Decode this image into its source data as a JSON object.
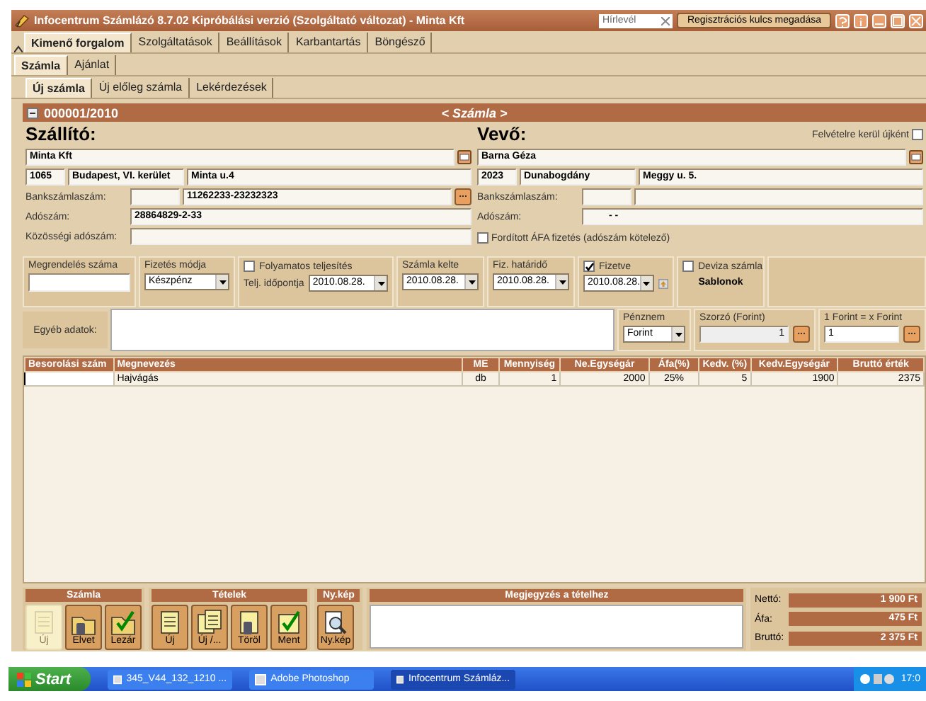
{
  "window": {
    "title": "Infocentrum Számlázó 8.7.02 Kipróbálási verzió (Szolgáltató változat) - Minta Kft",
    "search": {
      "placeholder": "Hírlevél"
    },
    "register_button": "Regisztrációs kulcs megadása"
  },
  "tabs": [
    {
      "label": "Kimenő forgalom",
      "selected": true
    },
    {
      "label": "Szolgáltatások",
      "selected": false
    },
    {
      "label": "Beállítások",
      "selected": false
    },
    {
      "label": "Karbantartás",
      "selected": false
    },
    {
      "label": "Böngésző",
      "selected": false
    }
  ],
  "subtabs": [
    {
      "label": "Számla",
      "selected": true
    },
    {
      "label": "Ajánlat",
      "selected": false
    }
  ],
  "invoice_tabs": [
    {
      "label": "Új számla",
      "selected": true
    },
    {
      "label": "Új előleg számla",
      "selected": false
    },
    {
      "label": "Lekérdezések",
      "selected": false
    }
  ],
  "invoice": {
    "number": "000001/2010",
    "type": "< Számla >"
  },
  "supplier": {
    "heading": "Szállító:",
    "name": "Minta Kft",
    "zip": "1065",
    "city": "Budapest, VI. kerület",
    "street": "Minta u.4",
    "bank_label": "Bankszámlaszám:",
    "bank_account": "11262233-23232323",
    "bank_button": "...",
    "tax_label": "Adószám:",
    "tax_number": "28864829-2-33",
    "eu_tax_label": "Közösségi adószám:"
  },
  "customer": {
    "heading": "Vevő:",
    "new_label": "Felvételre kerül újként",
    "new_checked": false,
    "name": "Barna Géza",
    "zip": "2023",
    "city": "Dunabogdány",
    "street": "Meggy u. 5.",
    "bank_label": "Bankszámlaszám:",
    "tax_label": "Adószám:",
    "tax_number": "- -",
    "reverse_vat_label": "Fordított ÁFA fizetés (adószám kötelező)",
    "reverse_vat_checked": false
  },
  "fields": [
    {
      "kind": "input",
      "label": "Megrendelés száma"
    },
    {
      "kind": "select",
      "label": "Fizetés módja",
      "value": "Készpénz"
    },
    {
      "kind": "check-date",
      "label": "Folyamatos teljesítés",
      "checked": false,
      "sublabel": "Telj. időpontja",
      "value": "2010.08.28."
    },
    {
      "kind": "date",
      "label": "Számla kelte",
      "value": "2010.08.28."
    },
    {
      "kind": "date",
      "label": "Fiz. határidő",
      "value": "2010.08.28."
    },
    {
      "kind": "check-date",
      "label": "Fizetve",
      "checked": true,
      "value": "2010.08.28.",
      "button": true
    },
    {
      "kind": "check-button",
      "label": "Deviza számla",
      "checked": false,
      "button_label": "Sablonok"
    }
  ],
  "other": {
    "label": "Egyéb adatok:",
    "currency_label": "Pénznem",
    "currency": "Forint",
    "multiplier_label": "Szorzó (Forint)",
    "multiplier": "1",
    "multiplier_button": "...",
    "rate_label": "1 Forint = x Forint",
    "rate": "1",
    "rate_button": "..."
  },
  "table": {
    "columns": [
      "Besorolási szám",
      "Megnevezés",
      "ME",
      "Mennyiség",
      "Ne.Egységár",
      "Áfa(%)",
      "Kedv. (%)",
      "Kedv.Egységár",
      "Bruttó érték"
    ],
    "rows": [
      {
        "cells": [
          "",
          "Hajvágás",
          "db",
          "1",
          "2000",
          "25%",
          "5",
          "1900",
          "2375"
        ]
      }
    ]
  },
  "toolbar": [
    {
      "title": "Számla",
      "buttons": [
        {
          "label": "Új",
          "disabled": true
        },
        {
          "label": "Elvet",
          "disabled": false
        },
        {
          "label": "Lezár",
          "disabled": false
        }
      ]
    },
    {
      "title": "Tételek",
      "buttons": [
        {
          "label": "Új",
          "disabled": false
        },
        {
          "label": "Új /...",
          "disabled": false
        },
        {
          "label": "Töröl",
          "disabled": false
        },
        {
          "label": "Ment",
          "disabled": false
        }
      ]
    },
    {
      "title": "Ny.kép",
      "buttons": [
        {
          "label": "Ny.kép",
          "disabled": false
        }
      ]
    }
  ],
  "note": {
    "title": "Megjegyzés a tételhez"
  },
  "totals": [
    {
      "label": "Nettó:",
      "value": "1 900 Ft"
    },
    {
      "label": "Áfa:",
      "value": "475 Ft"
    },
    {
      "label": "Bruttó:",
      "value": "2 375 Ft"
    }
  ],
  "taskbar": {
    "start": "Start",
    "items": [
      {
        "label": "345_V44_132_1210 ...",
        "selected": false
      },
      {
        "label": "Adobe Photoshop",
        "selected": false
      },
      {
        "label": "Infocentrum Számláz...",
        "selected": true
      }
    ],
    "clock": "17:0"
  }
}
